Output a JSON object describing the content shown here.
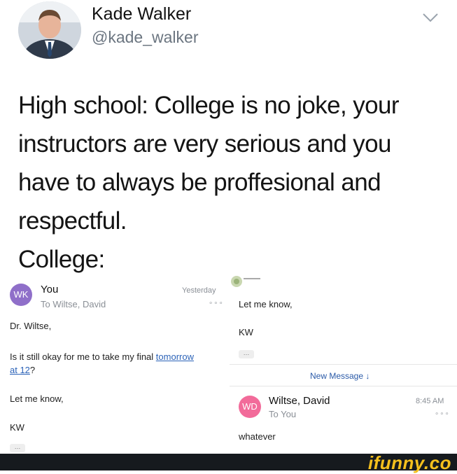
{
  "tweet": {
    "author_name": "Kade Walker",
    "handle": "@kade_walker",
    "text": "High school: College is no joke, your\ninstructors are very serious and you\nhave to always be proffesional and\nrespectful.\nCollege:"
  },
  "email_left": {
    "avatar_initials": "WK",
    "sender": "You",
    "recipient": "To Wiltse, David",
    "time": "Yesterday",
    "greeting": "Dr. Wiltse,",
    "body_prefix": "Is it still okay for me to take my final ",
    "body_link_1": "tomorrow",
    "body_link_2": "at 12",
    "body_suffix": "?",
    "closing": "Let me know,",
    "signature": "KW"
  },
  "email_right": {
    "closing": "Let me know,",
    "signature": "KW",
    "new_message_label": "New Message ↓",
    "reply": {
      "avatar_initials": "WD",
      "sender": "Wiltse, David",
      "recipient": "To You",
      "time": "8:45 AM",
      "body": "whatever"
    }
  },
  "footer": {
    "brand": "ifunny.co"
  },
  "colors": {
    "wk_avatar": "#8f6fc9",
    "wd_avatar": "#f26b9a",
    "link": "#2c63b8",
    "brand": "#f5c01d"
  }
}
